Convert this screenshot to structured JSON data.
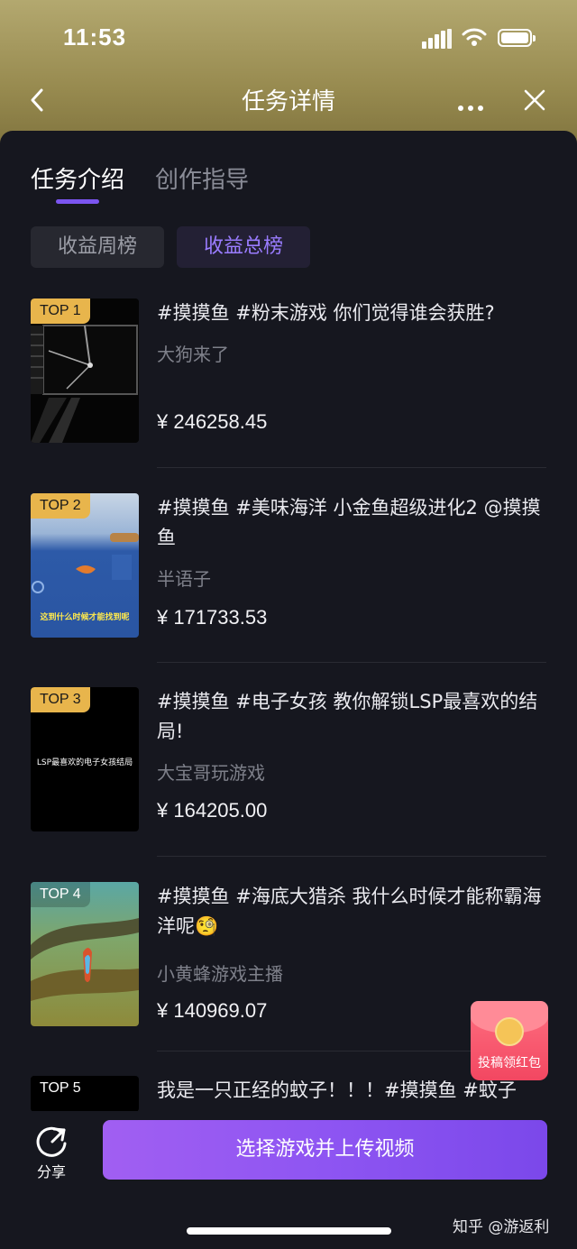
{
  "status_bar": {
    "time": "11:53"
  },
  "nav": {
    "title": "任务详情"
  },
  "tabs": [
    {
      "label": "任务介绍",
      "active": true
    },
    {
      "label": "创作指导",
      "active": false
    }
  ],
  "filters": [
    {
      "label": "收益周榜",
      "active": false
    },
    {
      "label": "收益总榜",
      "active": true
    }
  ],
  "items": [
    {
      "rank": "TOP 1",
      "title": "#摸摸鱼 #粉末游戏 你们觉得谁会获胜?",
      "author": "大狗来了",
      "amount": "¥ 246258.45"
    },
    {
      "rank": "TOP 2",
      "title": "#摸摸鱼 #美味海洋 小金鱼超级进化2 @摸摸鱼",
      "author": "半语子",
      "amount": "¥ 171733.53",
      "thumb_caption": "这到什么时候才能找到呢"
    },
    {
      "rank": "TOP 3",
      "title": "#摸摸鱼 #电子女孩 教你解锁LSP最喜欢的结局!",
      "author": "大宝哥玩游戏",
      "amount": "¥ 164205.00",
      "thumb_caption": "LSP最喜欢的电子女孩结局"
    },
    {
      "rank": "TOP 4",
      "title": "#摸摸鱼 #海底大猎杀 我什么时候才能称霸海洋呢🧐",
      "author": "小黄蜂游戏主播",
      "amount": "¥ 140969.07"
    },
    {
      "rank": "TOP 5",
      "title": "我是一只正经的蚊子！！！#摸摸鱼 #蚊子"
    }
  ],
  "float_button": {
    "label": "投稿领红包"
  },
  "bottom": {
    "share_label": "分享",
    "cta_label": "选择游戏并上传视频"
  },
  "watermark": "知乎 @游返利",
  "colors": {
    "accent": "#7b55f0",
    "badge": "#e8b54c",
    "cta": "#8e55f2"
  }
}
